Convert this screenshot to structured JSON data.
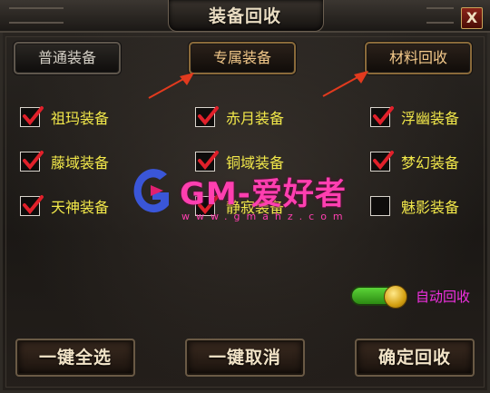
{
  "window": {
    "title": "装备回收",
    "close_label": "X"
  },
  "tabs": [
    {
      "label": "普通装备",
      "active": false
    },
    {
      "label": "专属装备",
      "active": true
    },
    {
      "label": "材料回收",
      "active": true
    }
  ],
  "equipment": [
    {
      "label": "祖玛装备",
      "checked": true
    },
    {
      "label": "赤月装备",
      "checked": true
    },
    {
      "label": "浮幽装备",
      "checked": true
    },
    {
      "label": "藤域装备",
      "checked": true
    },
    {
      "label": "铜域装备",
      "checked": true
    },
    {
      "label": "梦幻装备",
      "checked": true
    },
    {
      "label": "天神装备",
      "checked": true
    },
    {
      "label": "静寂装备",
      "checked": true
    },
    {
      "label": "魅影装备",
      "checked": false
    }
  ],
  "auto_recycle": {
    "label": "自动回收",
    "on": true
  },
  "buttons": {
    "select_all": "一键全选",
    "cancel_all": "一键取消",
    "confirm": "确定回收"
  },
  "watermark": {
    "main": "GM-爱好者",
    "sub": "www.gmahz.com"
  },
  "colors": {
    "label_yellow": "#f2e84a",
    "check_red": "#e0202a",
    "toggle_label": "#f230e2",
    "arrow_red": "#e23a1e"
  }
}
